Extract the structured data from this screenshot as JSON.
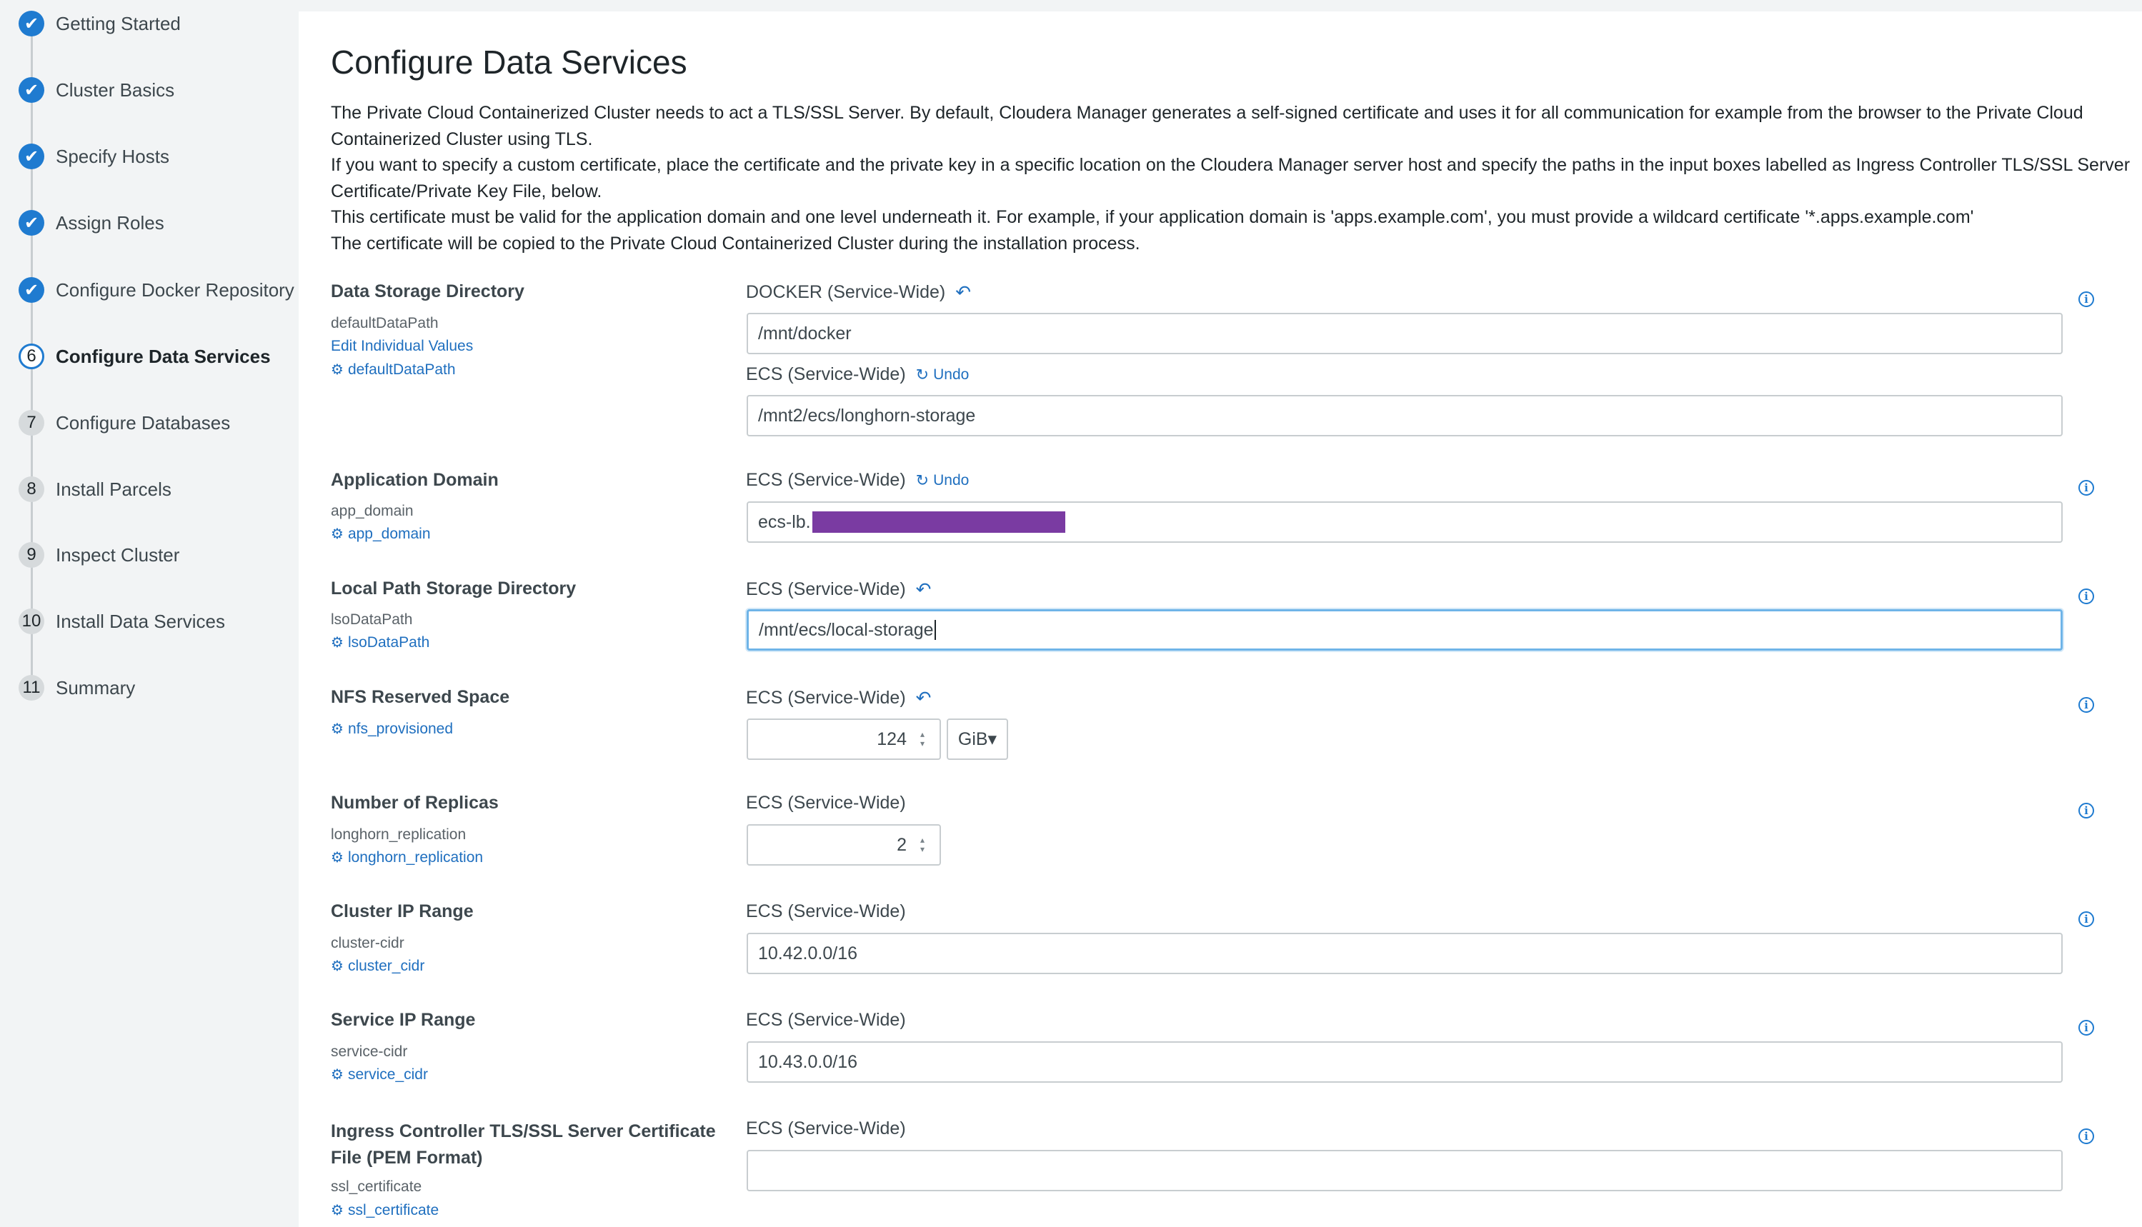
{
  "sidebar": {
    "steps": [
      {
        "marker": "✔",
        "label": "Getting Started",
        "state": "done"
      },
      {
        "marker": "✔",
        "label": "Cluster Basics",
        "state": "done"
      },
      {
        "marker": "✔",
        "label": "Specify Hosts",
        "state": "done"
      },
      {
        "marker": "✔",
        "label": "Assign Roles",
        "state": "done"
      },
      {
        "marker": "✔",
        "label": "Configure Docker Repository",
        "state": "done"
      },
      {
        "marker": "6",
        "label": "Configure Data Services",
        "state": "current"
      },
      {
        "marker": "7",
        "label": "Configure Databases",
        "state": "todo"
      },
      {
        "marker": "8",
        "label": "Install Parcels",
        "state": "todo"
      },
      {
        "marker": "9",
        "label": "Inspect Cluster",
        "state": "todo"
      },
      {
        "marker": "10",
        "label": "Install Data Services",
        "state": "todo"
      },
      {
        "marker": "11",
        "label": "Summary",
        "state": "todo"
      }
    ]
  },
  "main": {
    "title": "Configure Data Services",
    "intro": [
      "The Private Cloud Containerized Cluster needs to act a TLS/SSL Server. By default, Cloudera Manager generates a self-signed certificate and uses it for all communication for example from the browser to the Private Cloud Containerized Cluster using TLS.",
      "If you want to specify a custom certificate, place the certificate and the private key in a specific location on the Cloudera Manager server host and specify the paths in the input boxes labelled as Ingress Controller TLS/SSL Server Certificate/Private Key File, below.",
      "This certificate must be valid for the application domain and one level underneath it. For example, if your application domain is 'apps.example.com', you must provide a wildcard certificate '*.apps.example.com'",
      "The certificate will be copied to the Private Cloud Containerized Cluster during the installation process."
    ]
  },
  "config": {
    "data_storage": {
      "title": "Data Storage Directory",
      "key": "defaultDataPath",
      "edit_link": "Edit Individual Values",
      "link": "defaultDataPath",
      "scope1": "DOCKER (Service-Wide)",
      "value1": "/mnt/docker",
      "scope2": "ECS (Service-Wide)",
      "undo": "Undo",
      "value2": "/mnt2/ecs/longhorn-storage"
    },
    "app_domain": {
      "title": "Application Domain",
      "key": "app_domain",
      "link": "app_domain",
      "scope": "ECS (Service-Wide)",
      "undo": "Undo",
      "value": "ecs-lb."
    },
    "local_path": {
      "title": "Local Path Storage Directory",
      "key": "lsoDataPath",
      "link": "lsoDataPath",
      "scope": "ECS (Service-Wide)",
      "value": "/mnt/ecs/local-storage"
    },
    "nfs": {
      "title": "NFS Reserved Space",
      "link": "nfs_provisioned",
      "scope": "ECS (Service-Wide)",
      "value": "124",
      "unit": "GiB▾"
    },
    "replicas": {
      "title": "Number of Replicas",
      "key": "longhorn_replication",
      "link": "longhorn_replication",
      "scope": "ECS (Service-Wide)",
      "value": "2"
    },
    "cluster_ip": {
      "title": "Cluster IP Range",
      "key": "cluster-cidr",
      "link": "cluster_cidr",
      "scope": "ECS (Service-Wide)",
      "value": "10.42.0.0/16"
    },
    "service_ip": {
      "title": "Service IP Range",
      "key": "service-cidr",
      "link": "service_cidr",
      "scope": "ECS (Service-Wide)",
      "value": "10.43.0.0/16"
    },
    "ssl_cert": {
      "title_line1": "Ingress Controller TLS/SSL Server Certificate",
      "title_line2": "File (PEM Format)",
      "key": "ssl_certificate",
      "link": "ssl_certificate",
      "scope": "ECS (Service-Wide)",
      "value": ""
    }
  },
  "glyphs": {
    "revert_icon": "↶",
    "undo_icon": "↻",
    "gear_icon": "⚙",
    "info_icon": "i",
    "spin_up": "▴",
    "spin_down": "▾"
  },
  "colors": {
    "accent": "#1f7bd0",
    "link": "#1f6fbf",
    "redaction": "#7a3ba2"
  }
}
